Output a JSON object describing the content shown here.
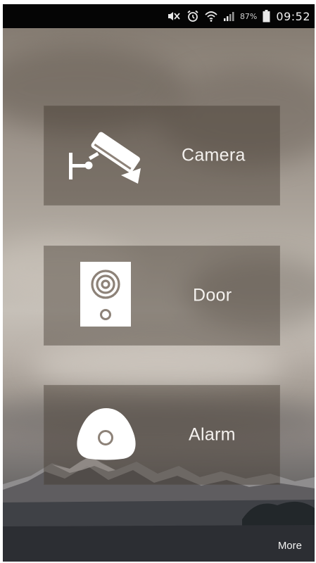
{
  "status_bar": {
    "icons": [
      "mute-icon",
      "alarm-clock-icon",
      "wifi-icon",
      "signal-icon",
      "battery-icon"
    ],
    "battery_percent": "87%",
    "time": "09:52"
  },
  "tiles": [
    {
      "label": "Camera",
      "icon": "cctv-camera-icon"
    },
    {
      "label": "Door",
      "icon": "doorbell-icon"
    },
    {
      "label": "Alarm",
      "icon": "alarm-sensor-icon"
    }
  ],
  "footer": {
    "more_label": "More"
  },
  "colors": {
    "status_bar_bg": "#050505",
    "tile_bg": "rgba(62,52,44,0.42)",
    "text": "#f4f1ee"
  }
}
